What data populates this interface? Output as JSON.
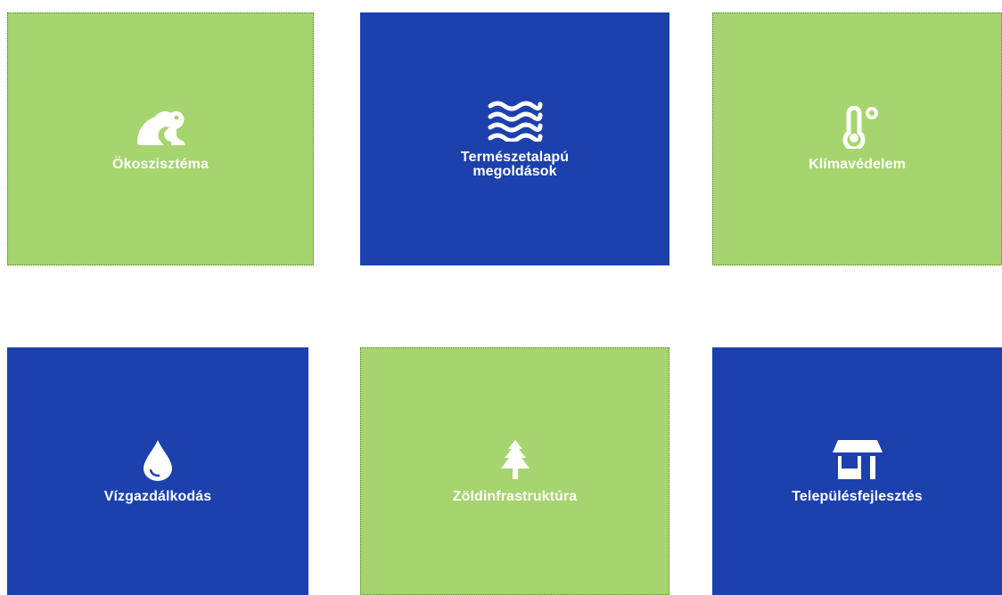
{
  "colors": {
    "green": "#a6d46e",
    "blue": "#1c41ad",
    "text": "#ffffff"
  },
  "tiles": [
    {
      "label": "Ökoszisztéma",
      "icon": "frog-icon",
      "color": "#a6d46e"
    },
    {
      "label": "Természetalapú megoldások",
      "icon": "water-waves-icon",
      "color": "#1c41ad"
    },
    {
      "label": "Klímavédelem",
      "icon": "thermometer-icon",
      "color": "#a6d46e"
    },
    {
      "label": "Vízgazdálkodás",
      "icon": "water-drop-icon",
      "color": "#1c41ad"
    },
    {
      "label": "Zöldinfrastruktúra",
      "icon": "pine-tree-icon",
      "color": "#a6d46e"
    },
    {
      "label": "Településfejlesztés",
      "icon": "storefront-icon",
      "color": "#1c41ad"
    }
  ]
}
